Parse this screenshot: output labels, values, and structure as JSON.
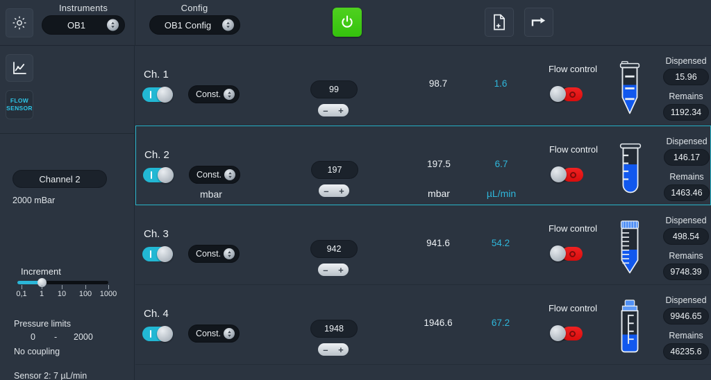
{
  "topbar": {
    "instruments_label": "Instruments",
    "instruments_value": "OB1",
    "config_label": "Config",
    "config_value": "OB1 Config",
    "gear_icon": "gear-icon",
    "power_icon": "power-icon",
    "newdoc_icon": "new-document-icon",
    "export_icon": "export-arrow-icon"
  },
  "sidebar": {
    "chart_icon": "chart-icon",
    "flow_sensor_line1": "FLOW",
    "flow_sensor_line2": "SENSOR",
    "channel_pill": "Channel 2",
    "max_pressure": "2000 mBar",
    "increment_label": "Increment",
    "increment_ticks": [
      "0,1",
      "1",
      "10",
      "100",
      "1000"
    ],
    "pressure_limits_label": "Pressure limits",
    "pressure_limit_min": "0",
    "pressure_limit_dash": "-",
    "pressure_limit_max": "2000",
    "coupling": "No coupling",
    "sensor_info": "Sensor 2: 7 µL/min"
  },
  "rows_common": {
    "flow_control_label": "Flow control",
    "dispensed_label": "Dispensed",
    "remains_label": "Remains",
    "mode_label": "Const.",
    "stepper_minus": "–",
    "stepper_plus": "+",
    "pressure_unit": "mbar",
    "flow_unit": "µL/min"
  },
  "channels": [
    {
      "name": "Ch. 1",
      "enabled": true,
      "mode": "Const.",
      "setpoint": "99",
      "measured_pressure": "98.7",
      "measured_flow": "1.6",
      "show_units": false,
      "pressure_unit": "mbar",
      "flow_unit": "µL/min",
      "flow_control_on": false,
      "dispensed": "15.96",
      "remains": "1192.34",
      "vessel": "eppendorf-tube",
      "fill_percent": 62
    },
    {
      "name": "Ch. 2",
      "enabled": true,
      "mode": "Const.",
      "setpoint": "197",
      "measured_pressure": "197.5",
      "measured_flow": "6.7",
      "show_units": true,
      "pressure_unit": "mbar",
      "flow_unit": "µL/min",
      "flow_control_on": false,
      "dispensed": "146.17",
      "remains": "1463.46",
      "vessel": "round-bottom-tube",
      "fill_percent": 63
    },
    {
      "name": "Ch. 3",
      "enabled": true,
      "mode": "Const.",
      "setpoint": "942",
      "measured_pressure": "941.6",
      "measured_flow": "54.2",
      "show_units": false,
      "pressure_unit": "mbar",
      "flow_unit": "µL/min",
      "flow_control_on": false,
      "dispensed": "498.54",
      "remains": "9748.39",
      "vessel": "falcon-tube",
      "fill_percent": 52
    },
    {
      "name": "Ch. 4",
      "enabled": true,
      "mode": "Const.",
      "setpoint": "1948",
      "measured_pressure": "1946.6",
      "measured_flow": "67.2",
      "show_units": false,
      "pressure_unit": "mbar",
      "flow_unit": "µL/min",
      "flow_control_on": false,
      "dispensed": "9946.65",
      "remains": "46235.6",
      "vessel": "bottle",
      "fill_percent": 42
    }
  ],
  "selected_row_index": 1,
  "colors": {
    "background": "#2b3440",
    "accent_cyan": "#22b8d4",
    "flow_text": "#2fb7db",
    "power_green": "#42c913",
    "alarm_red": "#e81414",
    "liquid_blue": "#1158ee"
  }
}
